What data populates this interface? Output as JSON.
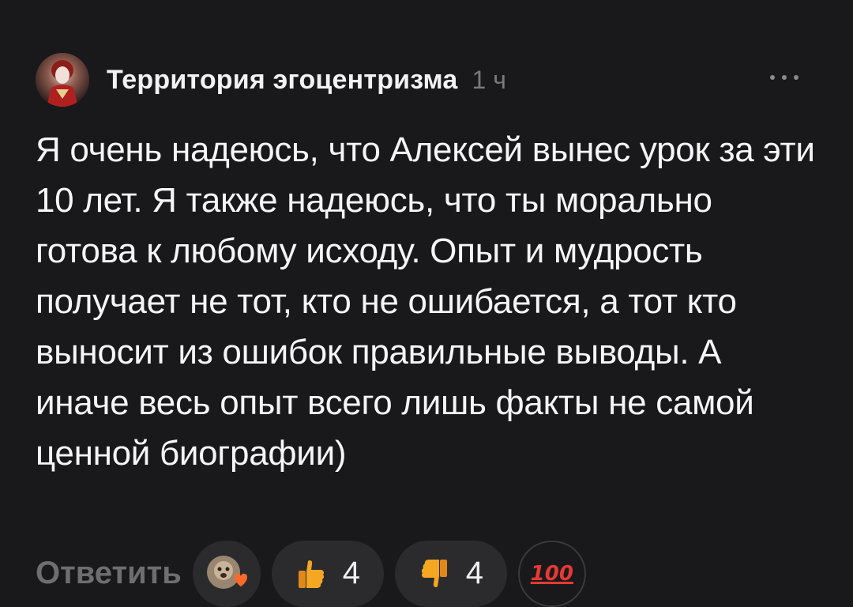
{
  "header": {
    "author": "Территория эгоцентризма",
    "time": "1 ч"
  },
  "comment": {
    "text": "Я очень надеюсь, что Алексей вынес урок за эти 10 лет. Я также надеюсь, что ты морально готова к любому исходу. Опыт и мудрость получает не тот, кто не ошибается, а тот кто выносит из ошибок правильные выводы. А иначе весь опыт всего лишь факты не самой ценной биографии)"
  },
  "actions": {
    "reply_label": "Ответить",
    "likes_count": "4",
    "dislikes_count": "4",
    "hundred_label": "100"
  },
  "colors": {
    "background": "#19191b",
    "pill": "#2b2b2e",
    "muted_text": "#6e6e72",
    "hundred_red": "#e53935",
    "thumb_orange": "#f59e0b"
  },
  "icons": [
    "author-avatar",
    "more-icon",
    "reaction-avatar-heart-icon",
    "thumbs-up-icon",
    "thumbs-down-icon",
    "hundred-points-icon"
  ]
}
